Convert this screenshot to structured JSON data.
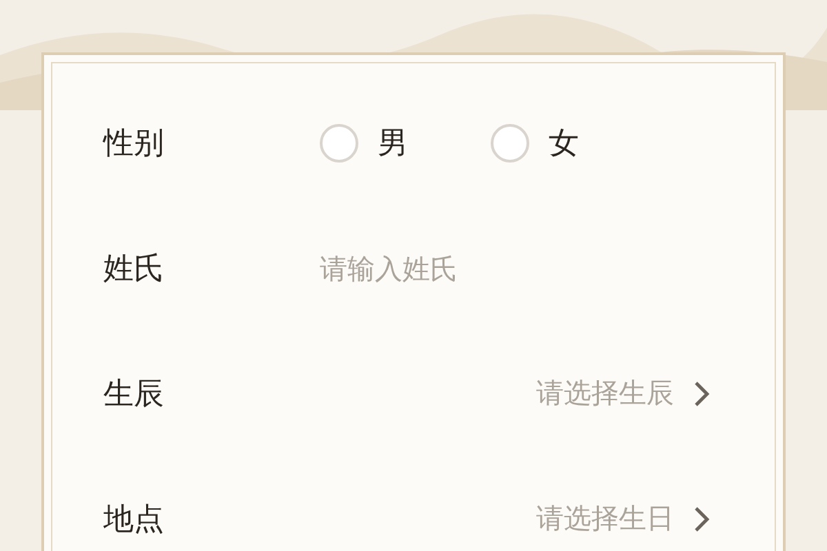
{
  "fields": [
    {
      "kind": "radio",
      "label": "性别",
      "options": [
        {
          "label": "男",
          "selected": false
        },
        {
          "label": "女",
          "selected": false
        }
      ]
    },
    {
      "kind": "text",
      "label": "姓氏",
      "placeholder": "请输入姓氏"
    },
    {
      "kind": "select",
      "label": "生辰",
      "placeholder": "请选择生辰"
    },
    {
      "kind": "select",
      "label": "地点",
      "placeholder": "请选择生日"
    }
  ]
}
